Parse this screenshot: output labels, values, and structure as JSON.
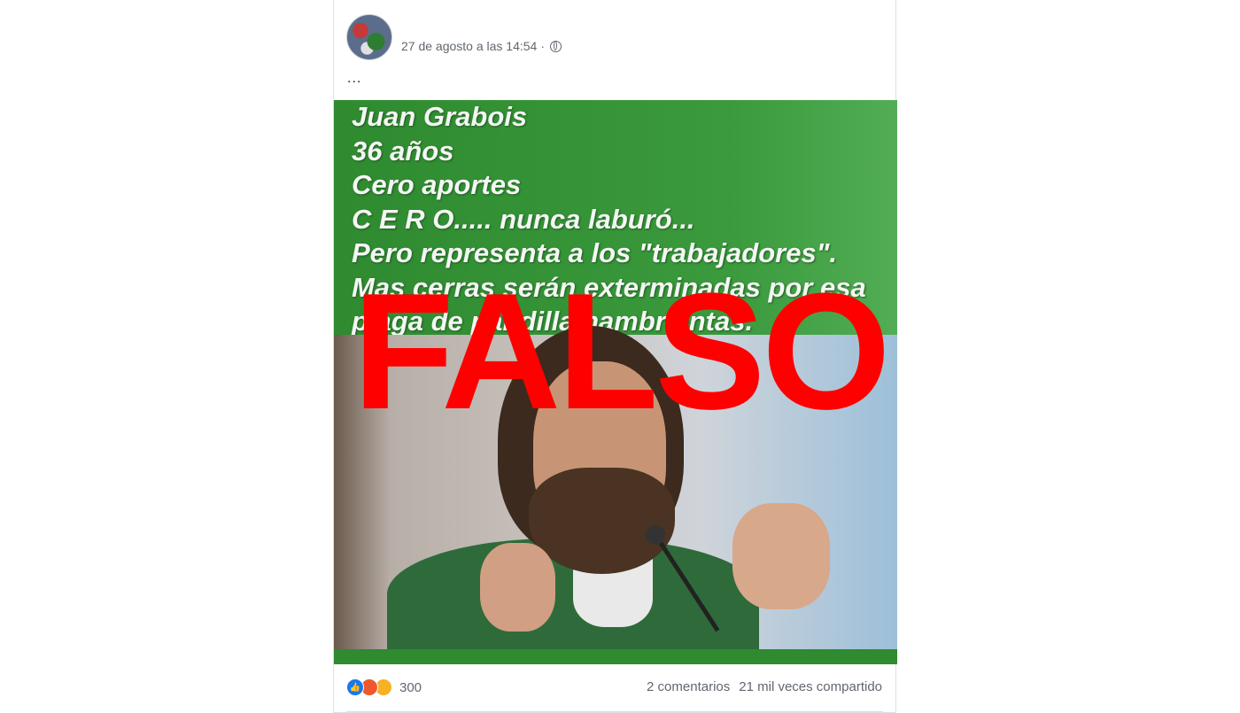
{
  "post": {
    "timestamp": "27 de agosto a las 14:54",
    "separator": "·",
    "more": "...",
    "meme_lines": [
      "Juan Grabois",
      "36 años",
      "Cero aportes",
      "C E R O..... nunca laburó...",
      "Pero representa a los \"trabajadores\".",
      "Mas cerras serán exterminadas por esa",
      "plaga de pandilla hambrientas."
    ],
    "stamp": "FALSO",
    "reactions_count": "300",
    "comments": "2 comentarios",
    "shares": "21 mil veces compartido"
  },
  "colors": {
    "image_green": "#3a9a3c",
    "stamp_red": "#ff0000",
    "like_blue": "#1877f2"
  },
  "icons": [
    "globe-icon",
    "like-icon",
    "angry-icon",
    "haha-icon"
  ]
}
